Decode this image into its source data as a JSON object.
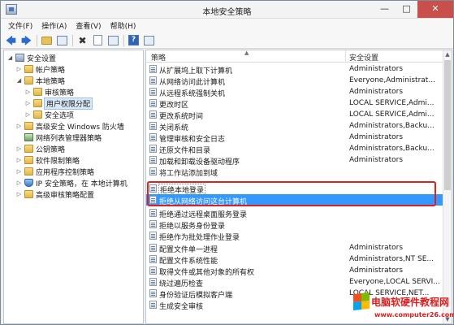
{
  "window": {
    "title": "本地安全策略"
  },
  "menubar": {
    "items": [
      "文件(F)",
      "操作(A)",
      "查看(V)",
      "帮助(H)"
    ]
  },
  "tree": {
    "items": [
      {
        "label": "安全设置"
      },
      {
        "label": "帐户策略"
      },
      {
        "label": "本地策略"
      },
      {
        "label": "审核策略"
      },
      {
        "label": "用户权限分配"
      },
      {
        "label": "安全选项"
      },
      {
        "label": "高级安全 Windows 防火墙"
      },
      {
        "label": "网络列表管理器策略"
      },
      {
        "label": "公钥策略"
      },
      {
        "label": "软件限制策略"
      },
      {
        "label": "应用程序控制策略"
      },
      {
        "label": "IP 安全策略，在 本地计算机"
      },
      {
        "label": "高级审核策略配置"
      }
    ]
  },
  "list": {
    "headers": {
      "policy": "策略",
      "security": "安全设置"
    },
    "rows": [
      {
        "policy": "从扩展坞上取下计算机",
        "security": "Administrators"
      },
      {
        "policy": "从网络访问此计算机",
        "security": "Everyone,Administrat..."
      },
      {
        "policy": "从远程系统强制关机",
        "security": "Administrators"
      },
      {
        "policy": "更改时区",
        "security": "LOCAL SERVICE,Admi..."
      },
      {
        "policy": "更改系统时间",
        "security": "LOCAL SERVICE,Admi..."
      },
      {
        "policy": "关闭系统",
        "security": "Administrators,Backu..."
      },
      {
        "policy": "管理审核和安全日志",
        "security": "Administrators"
      },
      {
        "policy": "还原文件和目录",
        "security": "Administrators,Backu..."
      },
      {
        "policy": "加载和卸载设备驱动程序",
        "security": "Administrators"
      },
      {
        "policy": "将工作站添加到域",
        "security": ""
      },
      {
        "policy": "拒绝本地登录",
        "security": ""
      },
      {
        "policy": "拒绝从网络访问这台计算机",
        "security": ""
      },
      {
        "policy": "拒绝通过远程桌面服务登录",
        "security": ""
      },
      {
        "policy": "拒绝以服务身份登录",
        "security": ""
      },
      {
        "policy": "拒绝作为批处理作业登录",
        "security": ""
      },
      {
        "policy": "配置文件单一进程",
        "security": "Administrators"
      },
      {
        "policy": "配置文件系统性能",
        "security": "Administrators,NT SE..."
      },
      {
        "policy": "取得文件或其他对象的所有权",
        "security": "Administrators"
      },
      {
        "policy": "绕过遍历检查",
        "security": "Everyone,LOCAL SERVI..."
      },
      {
        "policy": "身份验证后模拟客户端",
        "security": "LOCAL SERVICE,NET..."
      },
      {
        "policy": "生成安全审核",
        "security": ""
      }
    ]
  },
  "watermark": {
    "title": "电脑软硬件教程网",
    "url": "www.computer26.com"
  },
  "colors": {
    "highlight": "#3399ff",
    "annotation_box": "#e02020"
  }
}
